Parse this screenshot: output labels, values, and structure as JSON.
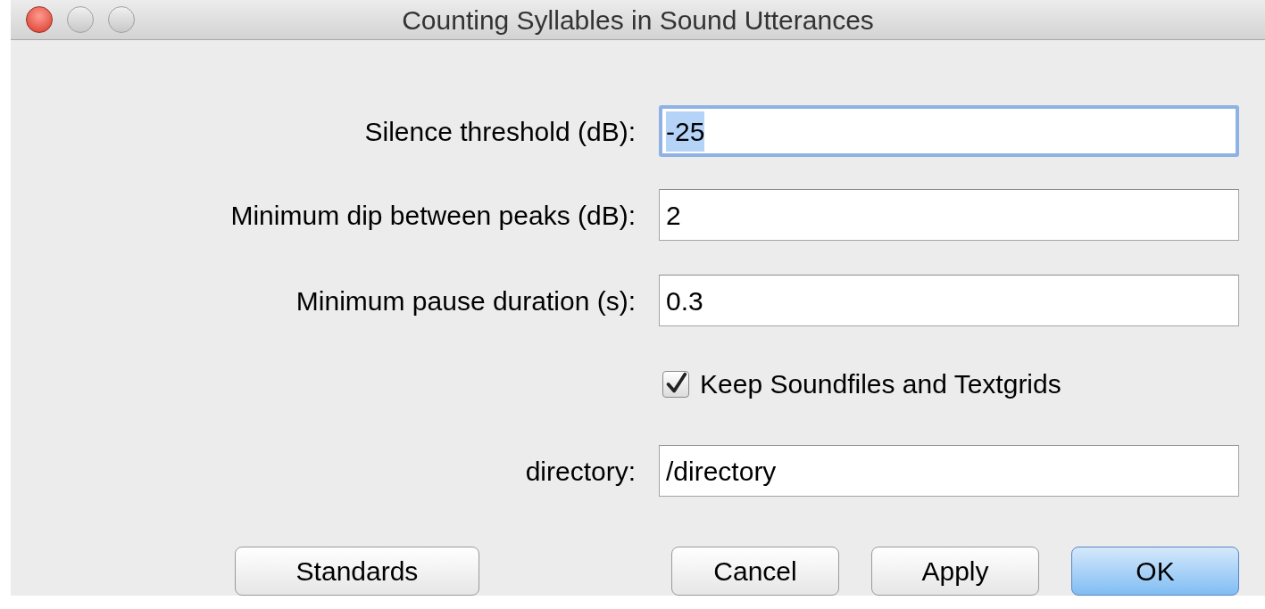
{
  "window": {
    "title": "Counting Syllables in Sound Utterances"
  },
  "fields": [
    {
      "label": "Silence threshold (dB):",
      "value": "-25",
      "focused": true
    },
    {
      "label": "Minimum dip between peaks (dB):",
      "value": "2",
      "focused": false
    },
    {
      "label": "Minimum pause duration (s):",
      "value": "0.3",
      "focused": false
    }
  ],
  "checkbox": {
    "label": "Keep Soundfiles and Textgrids",
    "checked": true
  },
  "directory_field": {
    "label": "directory:",
    "value": "/directory",
    "focused": false
  },
  "buttons": [
    {
      "label": "Standards",
      "default": false
    },
    {
      "label": "Cancel",
      "default": false
    },
    {
      "label": "Apply",
      "default": false
    },
    {
      "label": "OK",
      "default": true
    }
  ]
}
